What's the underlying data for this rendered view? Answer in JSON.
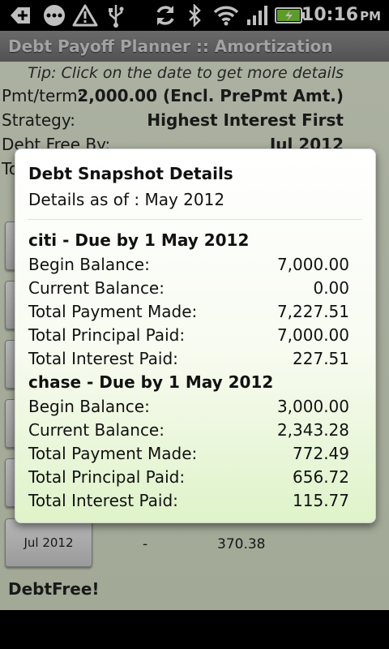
{
  "status_bar": {
    "time": "10:16",
    "ampm": "PM",
    "icons": [
      "add-icon",
      "chat-bubble-icon",
      "warning-icon",
      "usb-icon",
      "sync-icon",
      "bluetooth-icon",
      "wifi-icon",
      "signal-icon",
      "battery-charging-icon"
    ]
  },
  "app": {
    "title": "Debt Payoff Planner :: Amortization",
    "tip": "Tip: Click on the date to get more details",
    "info": [
      {
        "label": "Pmt/term:",
        "value": "2,000.00 (Encl. PrePmt Amt.)"
      },
      {
        "label": "Strategy:",
        "value": "Highest Interest First"
      },
      {
        "label": "Debt Free By:",
        "value": "Jul 2012"
      },
      {
        "label": "To",
        "value": ""
      }
    ],
    "last_row": {
      "date": "Jul 2012",
      "col2": "-",
      "col3": "370.38"
    },
    "footer_label": "DebtFree!"
  },
  "dialog": {
    "title": "Debt Snapshot Details",
    "subtitle": "Details as of : May 2012",
    "accounts": [
      {
        "header": "citi - Due by 1 May 2012",
        "rows": [
          {
            "label": "Begin Balance:",
            "value": "7,000.00"
          },
          {
            "label": "Current Balance:",
            "value": "0.00"
          },
          {
            "label": "Total Payment Made:",
            "value": "7,227.51"
          },
          {
            "label": "Total Principal Paid:",
            "value": "7,000.00"
          },
          {
            "label": "Total Interest Paid:",
            "value": "227.51"
          }
        ]
      },
      {
        "header": "chase - Due by 1 May 2012",
        "rows": [
          {
            "label": "Begin Balance:",
            "value": "3,000.00"
          },
          {
            "label": "Current Balance:",
            "value": "2,343.28"
          },
          {
            "label": "Total Payment Made:",
            "value": "772.49"
          },
          {
            "label": "Total Principal Paid:",
            "value": "656.72"
          },
          {
            "label": "Total Interest Paid:",
            "value": "115.77"
          }
        ]
      }
    ]
  }
}
